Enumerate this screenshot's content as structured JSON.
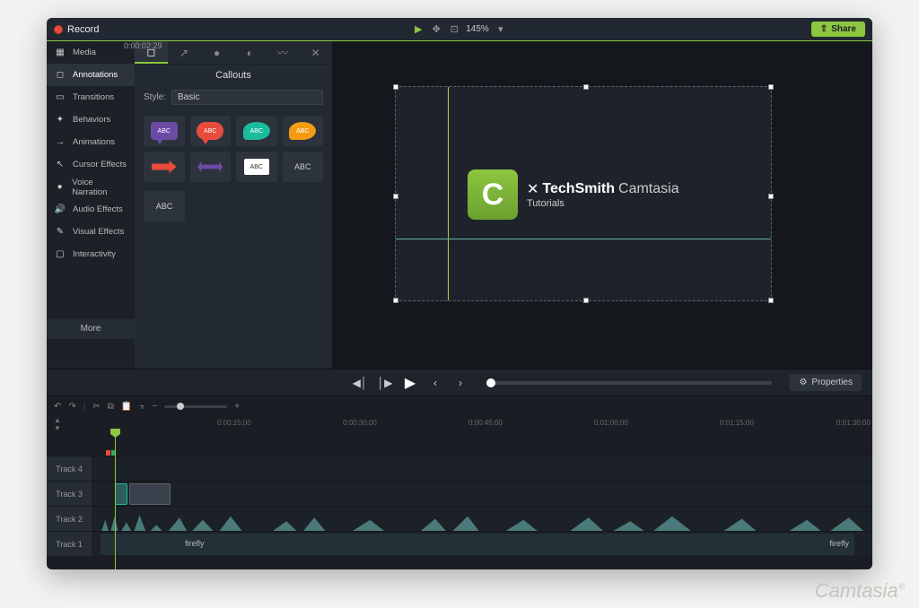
{
  "topbar": {
    "record": "Record",
    "zoom": "145%",
    "share": "Share"
  },
  "sidebar": {
    "items": [
      {
        "label": "Media",
        "icon": "▦"
      },
      {
        "label": "Annotations",
        "icon": "✎"
      },
      {
        "label": "Transitions",
        "icon": "▭"
      },
      {
        "label": "Behaviors",
        "icon": "✦"
      },
      {
        "label": "Animations",
        "icon": "→"
      },
      {
        "label": "Cursor Effects",
        "icon": "↖"
      },
      {
        "label": "Voice Narration",
        "icon": "●"
      },
      {
        "label": "Audio Effects",
        "icon": "♪"
      },
      {
        "label": "Visual Effects",
        "icon": "✎"
      },
      {
        "label": "Interactivity",
        "icon": "▢"
      }
    ],
    "more": "More"
  },
  "tools": {
    "panel_title": "Callouts",
    "style_label": "Style:",
    "style_value": "Basic",
    "abc": "ABC"
  },
  "canvas": {
    "brand1": "TechSmith",
    "brand2": "Camtasia",
    "brand3": "Tutorials",
    "logo_letter": "C"
  },
  "playback": {
    "properties": "Properties"
  },
  "timeline": {
    "current": "0:00:02;29",
    "ticks": [
      "0:00:15;00",
      "0:00:30;00",
      "0:00:45;00",
      "0:01:00;00",
      "0:01:15;00",
      "0:01:30;00"
    ],
    "tracks": [
      "Track 4",
      "Track 3",
      "Track 2",
      "Track 1"
    ],
    "clip_name": "firefly"
  },
  "watermark": "Camtasia"
}
